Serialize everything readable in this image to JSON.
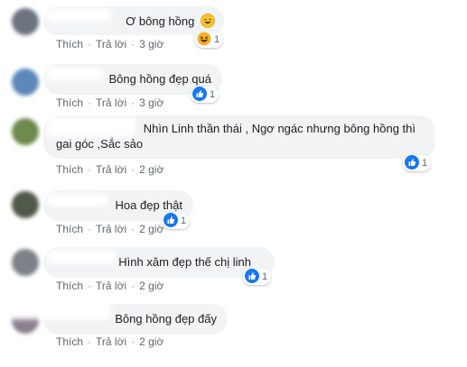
{
  "colors": {
    "bubble": "#f2f3f5",
    "meta": "#606770",
    "like_blue": "#1877f2",
    "haha_yellow": "#f7b125"
  },
  "actions": {
    "like": "Thích",
    "reply": "Trả lời",
    "dot": "·"
  },
  "comments": [
    {
      "text": "Ơ bông hồng",
      "emoji": "laughing-face",
      "time": "3 giờ",
      "reaction": "haha-icon",
      "count": "1"
    },
    {
      "text": "Bông hồng đẹp quá",
      "time": "3 giờ",
      "reaction": "like-icon",
      "count": "1"
    },
    {
      "text_line1": "Nhìn Linh thần thái , Ngơ ngác nhưng bông hồng thì",
      "text_line2": "gai góc ,Sắc sảo",
      "time": "2 giờ",
      "reaction": "like-icon",
      "count": "1"
    },
    {
      "text": "Hoa đẹp thật",
      "time": "2 giờ",
      "reaction": "like-icon",
      "count": "1"
    },
    {
      "text": "Hình xăm đẹp thế chị linh",
      "time": "2 giờ",
      "reaction": "like-icon",
      "count": "1"
    },
    {
      "text": "Bông hồng đẹp đấy",
      "time": "2 giờ"
    }
  ]
}
